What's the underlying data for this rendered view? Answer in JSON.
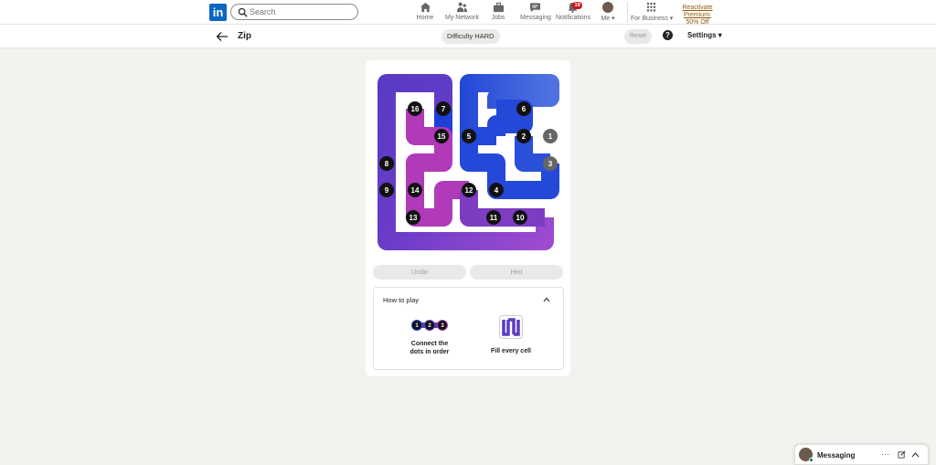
{
  "nav": {
    "logo_text": "in",
    "search_placeholder": "Search",
    "items": [
      {
        "label": "Home",
        "icon": "home-icon"
      },
      {
        "label": "My Network",
        "icon": "network-icon"
      },
      {
        "label": "Jobs",
        "icon": "briefcase-icon"
      },
      {
        "label": "Messaging",
        "icon": "messaging-icon"
      },
      {
        "label": "Notifications",
        "icon": "bell-icon",
        "badge": "16"
      },
      {
        "label": "Me",
        "icon": "avatar"
      },
      {
        "label": "For Business",
        "icon": "grid-icon"
      }
    ],
    "premium_line1": "Reactivate Premium:",
    "premium_line2": "50% Off"
  },
  "subbar": {
    "title": "Zip",
    "difficulty": "Difficulty HARD",
    "reset": "Reset",
    "help": "?",
    "settings": "Settings"
  },
  "game": {
    "dots": [
      {
        "n": "16",
        "state": "filled"
      },
      {
        "n": "7",
        "state": "filled"
      },
      {
        "n": "6",
        "state": "filled"
      },
      {
        "n": "15",
        "state": "filled"
      },
      {
        "n": "5",
        "state": "filled"
      },
      {
        "n": "2",
        "state": "filled"
      },
      {
        "n": "1",
        "state": "gray"
      },
      {
        "n": "8",
        "state": "filled"
      },
      {
        "n": "3",
        "state": "gray"
      },
      {
        "n": "9",
        "state": "filled"
      },
      {
        "n": "14",
        "state": "filled"
      },
      {
        "n": "12",
        "state": "filled"
      },
      {
        "n": "4",
        "state": "filled"
      },
      {
        "n": "13",
        "state": "filled"
      },
      {
        "n": "11",
        "state": "filled"
      },
      {
        "n": "10",
        "state": "filled"
      }
    ],
    "undo": "Undo",
    "hint": "Hint"
  },
  "howto": {
    "title": "How to play",
    "step1_dots": [
      "1",
      "2",
      "3"
    ],
    "step1_line1": "Connect the",
    "step1_line2": "dots in order",
    "step2": "Fill every cell"
  },
  "messaging": {
    "title": "Messaging",
    "more": "···"
  },
  "colors": {
    "brand": "#0a66c2",
    "path_start": "#2244d9",
    "path_mid": "#5b3bc4",
    "path_end": "#b03ab8"
  }
}
